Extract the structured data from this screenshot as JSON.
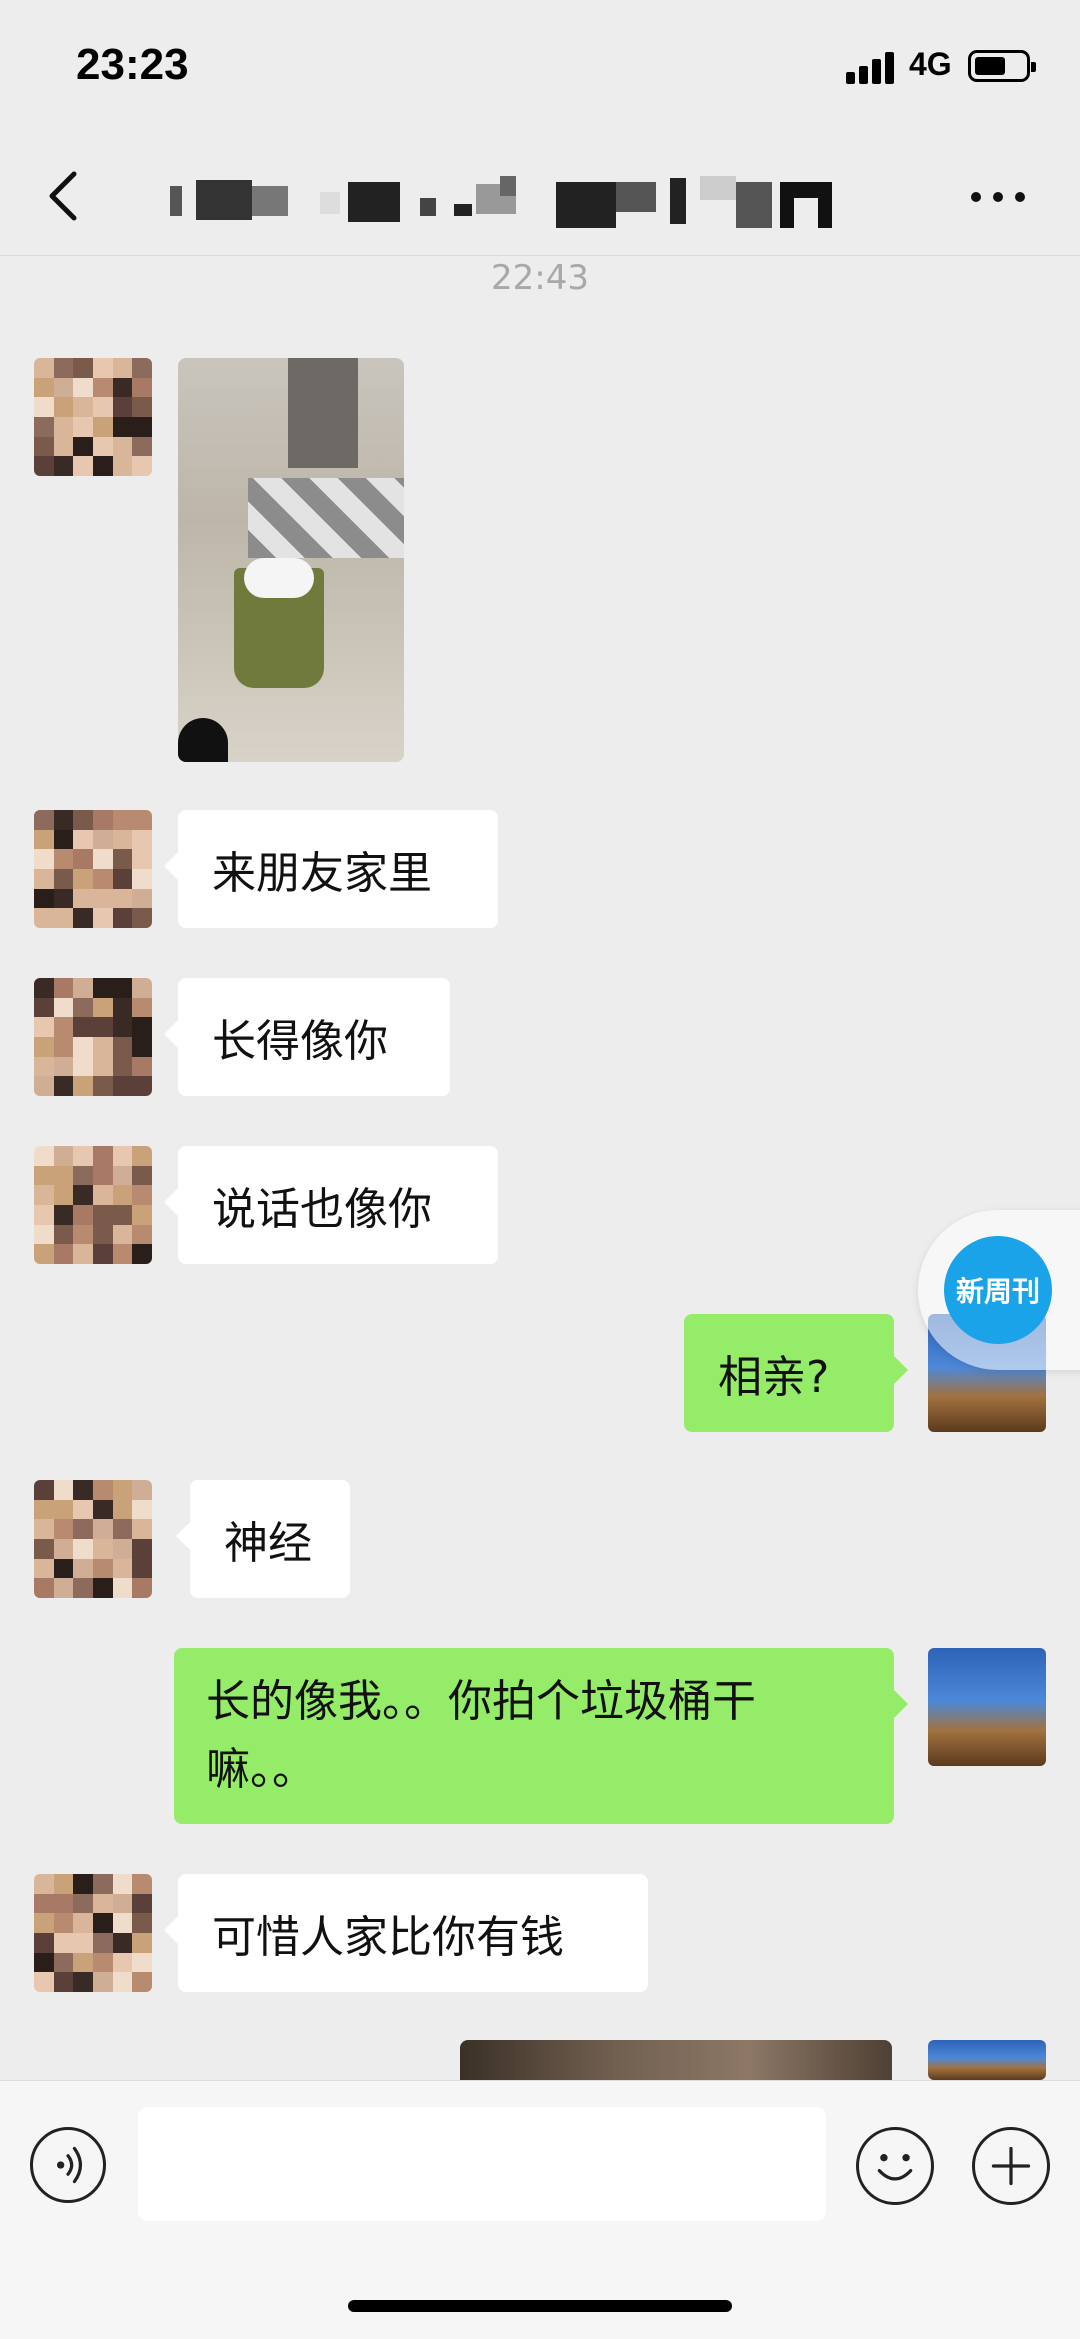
{
  "status_bar": {
    "time": "23:23",
    "network": "4G"
  },
  "header": {
    "title": ""
  },
  "chat": {
    "timestamp": "22:43",
    "messages": [
      {
        "side": "in",
        "type": "image"
      },
      {
        "side": "in",
        "text": "来朋友家里"
      },
      {
        "side": "in",
        "text": "长得像你"
      },
      {
        "side": "in",
        "text": "说话也像你"
      },
      {
        "side": "out",
        "text": "相亲?"
      },
      {
        "side": "in",
        "text": "神经"
      },
      {
        "side": "out",
        "text": "长的像我。。你拍个垃圾桶干嘛。。"
      },
      {
        "side": "in",
        "text": "可惜人家比你有钱"
      },
      {
        "side": "out",
        "type": "image"
      }
    ]
  },
  "watermark": {
    "text": "新周刊"
  },
  "icons": {
    "back": "chevron-left-icon",
    "more": "more-dots-icon",
    "voice": "voice-icon",
    "emoji": "emoji-icon",
    "plus": "plus-icon"
  },
  "colors": {
    "background": "#ededed",
    "outgoing_bubble": "#95ec69",
    "incoming_bubble": "#ffffff",
    "watermark": "#1aa3e8"
  }
}
